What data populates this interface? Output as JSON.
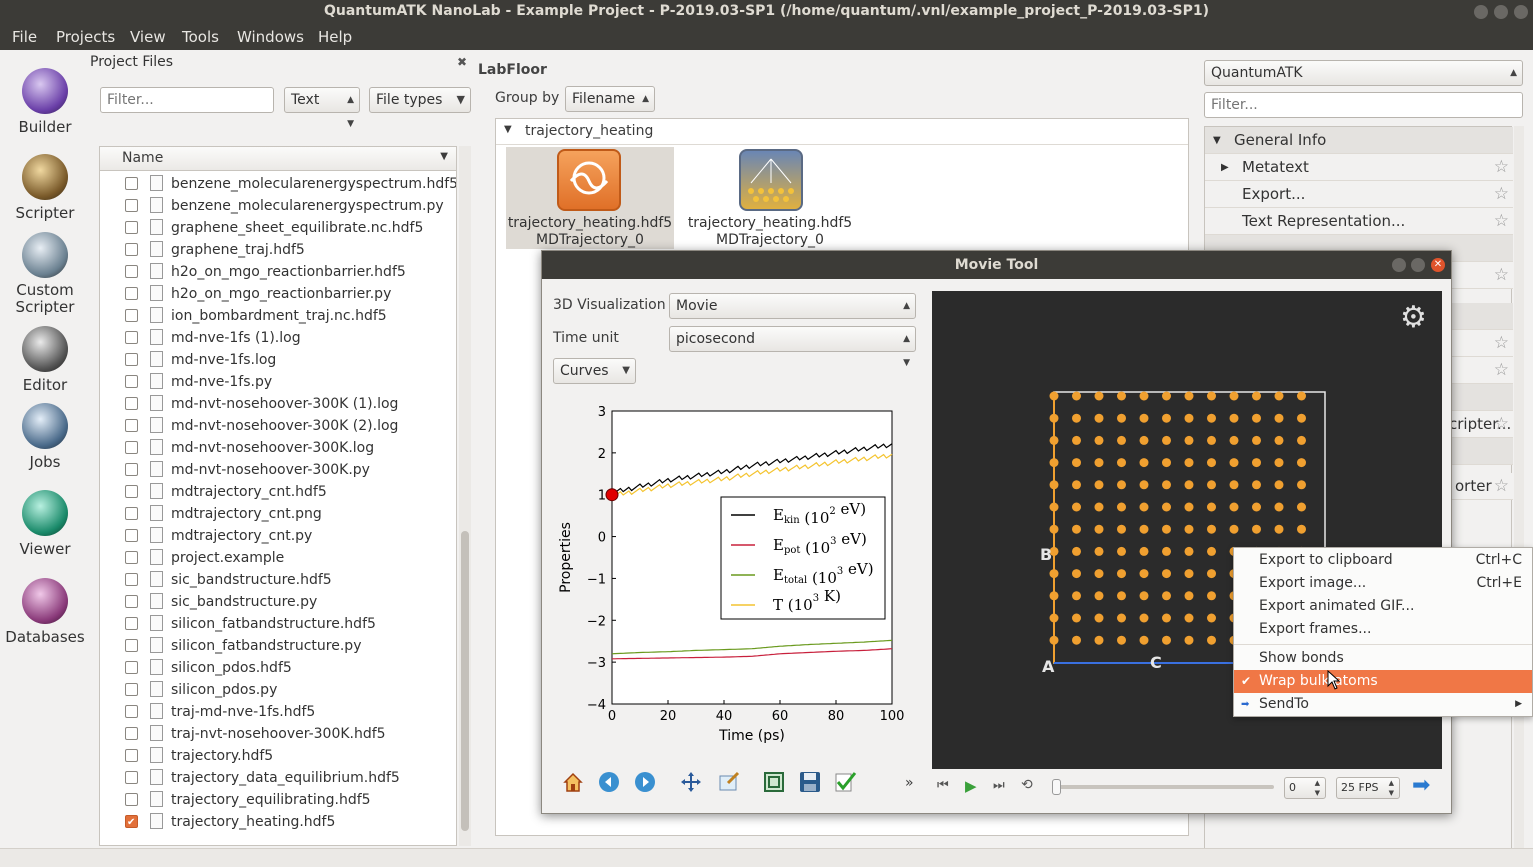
{
  "window": {
    "title": "QuantumATK NanoLab - Example Project - P-2019.03-SP1 (/home/quantum/.vnl/example_project_P-2019.03-SP1)"
  },
  "menubar": {
    "items": [
      "File",
      "Projects",
      "View",
      "Tools",
      "Windows",
      "Help"
    ]
  },
  "leftbar": {
    "tools": [
      {
        "label": "Builder",
        "icon": "builder-icon"
      },
      {
        "label": "Scripter",
        "icon": "scripter-icon"
      },
      {
        "label": "Custom\nScripter",
        "icon": "custom-scripter-icon"
      },
      {
        "label": "Editor",
        "icon": "editor-icon"
      },
      {
        "label": "Jobs",
        "icon": "jobs-icon"
      },
      {
        "label": "Viewer",
        "icon": "viewer-icon"
      },
      {
        "label": "Databases",
        "icon": "databases-icon"
      }
    ]
  },
  "project_files": {
    "title": "Project Files",
    "filter_placeholder": "Filter...",
    "type_select": "Text",
    "file_types_select": "File types",
    "column_name": "Name",
    "files": [
      {
        "name": "benzene_molecularenergyspectrum.hdf5",
        "checked": false
      },
      {
        "name": "benzene_molecularenergyspectrum.py",
        "checked": false
      },
      {
        "name": "graphene_sheet_equilibrate.nc.hdf5",
        "checked": false
      },
      {
        "name": "graphene_traj.hdf5",
        "checked": false
      },
      {
        "name": "h2o_on_mgo_reactionbarrier.hdf5",
        "checked": false
      },
      {
        "name": "h2o_on_mgo_reactionbarrier.py",
        "checked": false
      },
      {
        "name": "ion_bombardment_traj.nc.hdf5",
        "checked": false
      },
      {
        "name": "md-nve-1fs (1).log",
        "checked": false
      },
      {
        "name": "md-nve-1fs.log",
        "checked": false
      },
      {
        "name": "md-nve-1fs.py",
        "checked": false
      },
      {
        "name": "md-nvt-nosehoover-300K (1).log",
        "checked": false
      },
      {
        "name": "md-nvt-nosehoover-300K (2).log",
        "checked": false
      },
      {
        "name": "md-nvt-nosehoover-300K.log",
        "checked": false
      },
      {
        "name": "md-nvt-nosehoover-300K.py",
        "checked": false
      },
      {
        "name": "mdtrajectory_cnt.hdf5",
        "checked": false
      },
      {
        "name": "mdtrajectory_cnt.png",
        "checked": false
      },
      {
        "name": "mdtrajectory_cnt.py",
        "checked": false
      },
      {
        "name": "project.example",
        "checked": false
      },
      {
        "name": "sic_bandstructure.hdf5",
        "checked": false
      },
      {
        "name": "sic_bandstructure.py",
        "checked": false
      },
      {
        "name": "silicon_fatbandstructure.hdf5",
        "checked": false
      },
      {
        "name": "silicon_fatbandstructure.py",
        "checked": false
      },
      {
        "name": "silicon_pdos.hdf5",
        "checked": false
      },
      {
        "name": "silicon_pdos.py",
        "checked": false
      },
      {
        "name": "traj-md-nve-1fs.hdf5",
        "checked": false
      },
      {
        "name": "traj-nvt-nosehoover-300K.hdf5",
        "checked": false
      },
      {
        "name": "trajectory.hdf5",
        "checked": false
      },
      {
        "name": "trajectory_data_equilibrium.hdf5",
        "checked": false
      },
      {
        "name": "trajectory_equilibrating.hdf5",
        "checked": false
      },
      {
        "name": "trajectory_heating.hdf5",
        "checked": true
      }
    ]
  },
  "labfloor": {
    "title": "LabFloor",
    "group_by_label": "Group by",
    "group_by_value": "Filename",
    "group_name": "trajectory_heating",
    "items": [
      {
        "file": "trajectory_heating.hdf5",
        "object": "MDTrajectory_0",
        "selected": true
      },
      {
        "file": "trajectory_heating.hdf5",
        "object": "MDTrajectory_0",
        "selected": false
      }
    ]
  },
  "movie_tool": {
    "title": "Movie Tool",
    "vis_label": "3D Visualization",
    "vis_value": "Movie",
    "time_unit_label": "Time unit",
    "time_unit_value": "picosecond",
    "curves_label": "Curves",
    "frame_value": "0",
    "fps_value": "25 FPS",
    "cell_labels": {
      "b": "B",
      "c": "C",
      "a": "A"
    },
    "more": "»"
  },
  "chart_data": {
    "type": "line",
    "xlabel": "Time (ps)",
    "ylabel": "Properties",
    "xlim": [
      0,
      100
    ],
    "ylim": [
      -4,
      3
    ],
    "xticks": [
      "0",
      "20",
      "40",
      "60",
      "80",
      "100"
    ],
    "yticks": [
      "3",
      "2",
      "1",
      "0",
      "−1",
      "−2",
      "−3",
      "−4"
    ],
    "legend_placement": "center-right",
    "marker": {
      "x": 0,
      "y": 1.0,
      "color": "#e00000"
    },
    "series": [
      {
        "name": "E",
        "sub": "kin",
        "unit": " (10",
        "exp": "2",
        "unit_end": " eV)",
        "color": "#000000",
        "x": [
          0,
          10,
          20,
          30,
          40,
          50,
          60,
          70,
          80,
          90,
          100
        ],
        "y": [
          1.05,
          1.2,
          1.35,
          1.45,
          1.55,
          1.7,
          1.8,
          1.9,
          2.0,
          2.1,
          2.2
        ]
      },
      {
        "name": "E",
        "sub": "pot",
        "unit": " (10",
        "exp": "3",
        "unit_end": " eV)",
        "color": "#c8203c",
        "x": [
          0,
          10,
          20,
          30,
          40,
          50,
          60,
          70,
          80,
          90,
          100
        ],
        "y": [
          -2.92,
          -2.91,
          -2.9,
          -2.89,
          -2.88,
          -2.86,
          -2.8,
          -2.77,
          -2.74,
          -2.72,
          -2.68
        ]
      },
      {
        "name": "E",
        "sub": "total",
        "unit": " (10",
        "exp": "3",
        "unit_end": " eV)",
        "color": "#6a9a1e",
        "x": [
          0,
          10,
          20,
          30,
          40,
          50,
          60,
          70,
          80,
          90,
          100
        ],
        "y": [
          -2.8,
          -2.77,
          -2.75,
          -2.72,
          -2.7,
          -2.68,
          -2.62,
          -2.58,
          -2.55,
          -2.52,
          -2.48
        ]
      },
      {
        "name": "T",
        "sub": "",
        "unit": " (10",
        "exp": "3",
        "unit_end": " K)",
        "color": "#f4c430",
        "x": [
          0,
          10,
          20,
          30,
          40,
          50,
          60,
          70,
          80,
          90,
          100
        ],
        "y": [
          0.98,
          1.1,
          1.22,
          1.3,
          1.38,
          1.5,
          1.6,
          1.68,
          1.78,
          1.86,
          1.95
        ]
      }
    ]
  },
  "context_menu": {
    "items": [
      {
        "label": "Export to clipboard",
        "shortcut": "Ctrl+C"
      },
      {
        "label": "Export image...",
        "shortcut": "Ctrl+E"
      },
      {
        "label": "Export animated GIF...",
        "shortcut": ""
      },
      {
        "label": "Export frames...",
        "shortcut": ""
      },
      {
        "label": "Show bonds",
        "shortcut": ""
      },
      {
        "label": "Wrap bulk atoms",
        "shortcut": "",
        "checked": true,
        "highlighted": true
      },
      {
        "label": "SendTo",
        "shortcut": "",
        "submenu": true
      }
    ]
  },
  "right_panel": {
    "engine_select": "QuantumATK",
    "filter_placeholder": "Filter...",
    "section": "General Info",
    "rows": [
      "Metatext",
      "Export...",
      "Text Representation..."
    ],
    "partial_rows": [
      "cripter...",
      "orter"
    ]
  },
  "colors": {
    "accent": "#f07746",
    "titlebar": "#3c3b37",
    "viewport": "#2b2b2b",
    "atom": "#f0a030"
  }
}
